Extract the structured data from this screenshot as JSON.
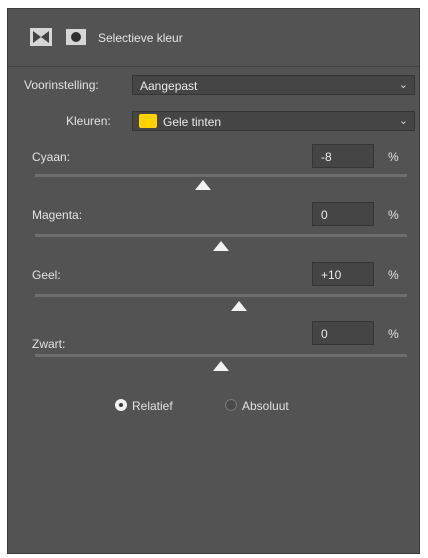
{
  "header": {
    "icons": [
      "adjustment-layer-icon",
      "mask-icon"
    ],
    "title": "Selectieve kleur"
  },
  "preset": {
    "label": "Voorinstelling:",
    "value": "Aangepast"
  },
  "colors": {
    "label": "Kleuren:",
    "value": "Gele tinten",
    "swatch_color": "#ffd200"
  },
  "sliders": [
    {
      "label": "Cyaan:",
      "value": "-8",
      "unit": "%",
      "level_percent": -8
    },
    {
      "label": "Magenta:",
      "value": "0",
      "unit": "%",
      "level_percent": 0
    },
    {
      "label": "Geel:",
      "value": "+10",
      "unit": "%",
      "level_percent": 10
    },
    {
      "label": "Zwart:",
      "value": "0",
      "unit": "%",
      "level_percent": 0
    }
  ],
  "method": {
    "options": [
      "Relatief",
      "Absoluut"
    ],
    "selected": "Relatief"
  }
}
